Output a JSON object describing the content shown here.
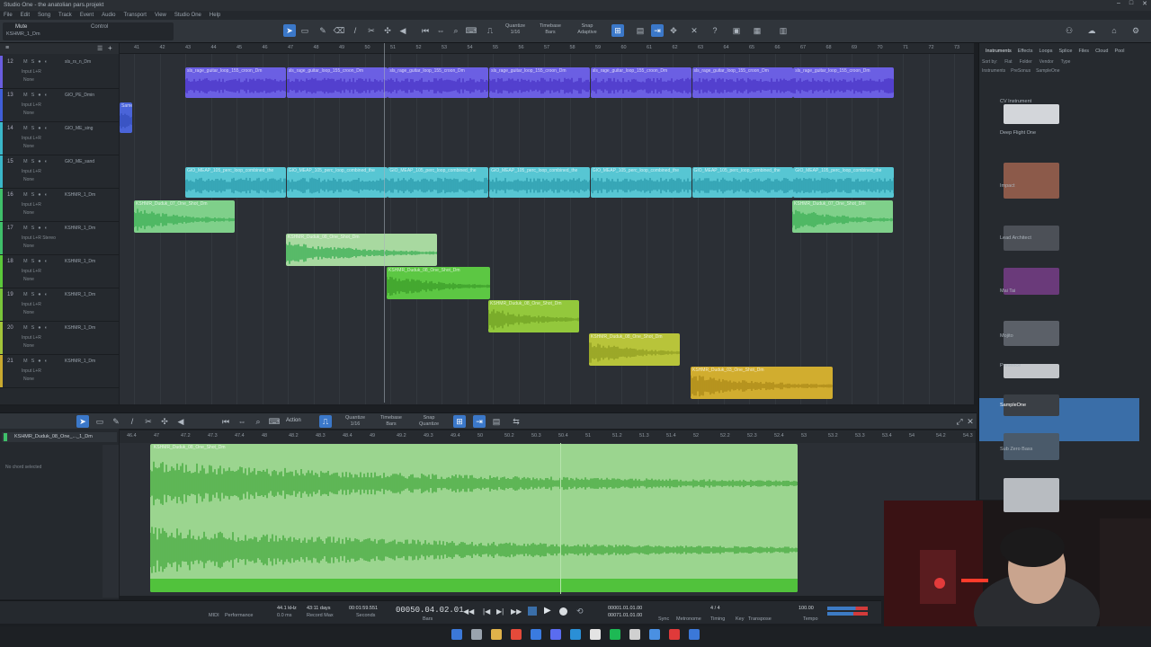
{
  "window": {
    "title": "Studio One - the anatolian pars.projekt",
    "menu": [
      "File",
      "Edit",
      "Song",
      "Track",
      "Event",
      "Audio",
      "Transport",
      "View",
      "Studio One",
      "Help"
    ]
  },
  "toolbar": {
    "left_label": "Mute",
    "left_sub": "KSHMR_1_Dm",
    "control": "Control",
    "quantize": {
      "title": "Quantize",
      "value": "1/16"
    },
    "timebase": {
      "title": "Timebase",
      "value": "Bars"
    },
    "snap": {
      "title": "Snap",
      "value": "Adaptive"
    }
  },
  "ruler": [
    "41",
    "42",
    "43",
    "44",
    "45",
    "46",
    "47",
    "48",
    "49",
    "50",
    "51",
    "52",
    "53",
    "54",
    "55",
    "56",
    "57",
    "58",
    "59",
    "60",
    "61",
    "62",
    "63",
    "64",
    "65",
    "66",
    "67",
    "68",
    "69",
    "70",
    "71",
    "72",
    "73"
  ],
  "tracks": [
    {
      "num": "12",
      "name": "sls_rs_n_Dm",
      "input": "Input L+R",
      "route": "None",
      "color": "#6a5de0"
    },
    {
      "num": "13",
      "name": "GIO_PE_Dmin",
      "input": "Input L+R",
      "route": "None",
      "color": "#3f5ed8"
    },
    {
      "num": "14",
      "name": "GIO_ME_sing",
      "input": "Input L+R",
      "route": "None",
      "color": "#3ab7c9"
    },
    {
      "num": "15",
      "name": "GIO_ME_sand",
      "input": "Input L+R",
      "route": "None",
      "color": "#3ab7c9"
    },
    {
      "num": "16",
      "name": "KSHMR_1_Dm",
      "input": "Input L+R",
      "route": "None",
      "color": "#3fbf6a"
    },
    {
      "num": "17",
      "name": "KSHMR_1_Dm",
      "input": "Input L+R Stereo",
      "route": "None",
      "color": "#3fbf6a"
    },
    {
      "num": "18",
      "name": "KSHMR_1_Dm",
      "input": "Input L+R",
      "route": "None",
      "color": "#5bc83a"
    },
    {
      "num": "19",
      "name": "KSHMR_1_Dm",
      "input": "Input L+R",
      "route": "None",
      "color": "#79c43a"
    },
    {
      "num": "20",
      "name": "KSHMR_1_Dm",
      "input": "Input L+R",
      "route": "None",
      "color": "#a3c43a"
    },
    {
      "num": "21",
      "name": "KSHMR_1_Dm",
      "input": "Input L+R",
      "route": "None",
      "color": "#c9a92f"
    }
  ],
  "clips": {
    "guitar_label": "sls_rage_guitar_loop_155_croon_Dm",
    "perc_label": "GIO_MEAP_105_perc_loop_combined_the",
    "duduk_07": "KSHMR_Duduk_07_One_Shot_Dm",
    "duduk_08": "KSHMR_Duduk_08_One_Shot_Dm",
    "duduk_03": "KSHMR_Duduk_03_One_Shot_Dm",
    "small_label": "Same"
  },
  "browser": {
    "tabs": [
      "Instruments",
      "Effects",
      "Loops",
      "Splice",
      "Files",
      "Cloud",
      "Pool"
    ],
    "sort_row": [
      "Sort by:",
      "Flat",
      "Folder",
      "Vendor",
      "Type"
    ],
    "path": [
      "Instruments",
      "PreSonus",
      "SampleOne"
    ],
    "items": [
      "CV Instrument",
      "Deep Flight One",
      "Impact",
      "Lead Architect",
      "Mai Tai",
      "Mojito",
      "Presence",
      "SampleOne",
      "Sub Zero Bass"
    ]
  },
  "editor": {
    "track_name": "KSHMR_Duduk_08_One_..._1_Dm",
    "no_chord": "No chord selected",
    "action": "Action",
    "quantize": {
      "title": "Quantize",
      "value": "1/16"
    },
    "timebase": {
      "title": "Timebase",
      "value": "Bars"
    },
    "snap": {
      "title": "Snap",
      "value": "Quantize"
    },
    "clip_label": "KSHMR_Duduk_08_One_Shot_Dm",
    "ruler": [
      "46.4",
      "47",
      "47.2",
      "47.3",
      "47.4",
      "48",
      "48.2",
      "48.3",
      "48.4",
      "49",
      "49.2",
      "49.3",
      "49.4",
      "50",
      "50.2",
      "50.3",
      "50.4",
      "51",
      "51.2",
      "51.3",
      "51.4",
      "52",
      "52.2",
      "52.3",
      "52.4",
      "53",
      "53.2",
      "53.3",
      "53.4",
      "54",
      "54.2",
      "54.3"
    ]
  },
  "transport": {
    "sample_rate": "44.1 kHz",
    "latency": "0.0 ms",
    "record_max": "43:11 days",
    "record_label": "Record Max",
    "seconds": "00:01:59.551",
    "seconds_label": "Seconds",
    "bars_position": "00050.04.02.01",
    "bars_label": "Bars",
    "loop_start": "00001.01.01.00",
    "loop_end": "00071.01.01.00",
    "signature": "4 / 4",
    "tempo": "100.00",
    "perf_label": "Performance",
    "midi_label": "MIDI",
    "sync_label": "Sync",
    "metronome_label": "Metronome",
    "timing_label": "Timing",
    "key_label": "Key",
    "transpose_label": "Transpose",
    "tempo_label": "Tempo"
  }
}
